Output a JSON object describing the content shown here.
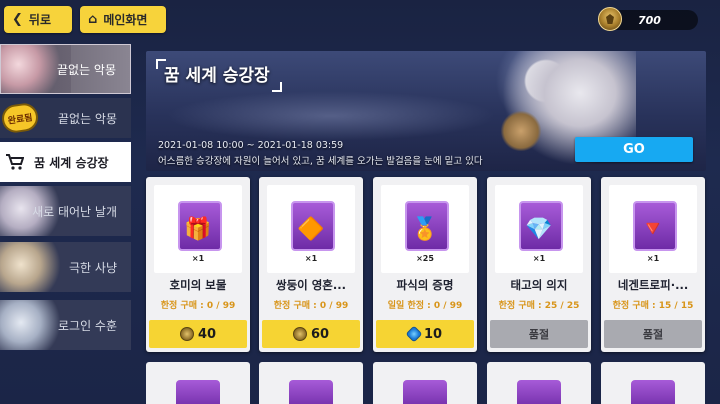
{
  "topbar": {
    "back_label": "뒤로",
    "main_label": "메인화면",
    "currency_value": "700"
  },
  "sidebar": {
    "items": [
      {
        "label": "끝없는 악몽"
      },
      {
        "label": "끝없는 악몽",
        "badge": "완료됨"
      },
      {
        "label": "꿈 세계 승강장"
      },
      {
        "label": "새로 태어난 날개"
      },
      {
        "label": "극한 사냥"
      },
      {
        "label": "로그인 수훈"
      }
    ]
  },
  "banner": {
    "title": "꿈 세계 승강장",
    "date": "2021-01-08 10:00 ~ 2021-01-18 03:59",
    "description": "어스름한 승강장에 자원이 늘어서 있고, 꿈 세계를 오가는 발걸음을 눈에 밑고 있다",
    "go_label": "GO"
  },
  "cards": [
    {
      "name": "호미의 보물",
      "qty": "×1",
      "limit": "한정 구매 : 0 / 99",
      "price": "40",
      "price_icon": "coin-icon"
    },
    {
      "name": "쌍둥이 영혼...",
      "qty": "×1",
      "limit": "한정 구매 : 0 / 99",
      "price": "60",
      "price_icon": "coin-icon"
    },
    {
      "name": "파식의 증명",
      "qty": "×25",
      "limit": "일일 한정 : 0 / 99",
      "price": "10",
      "price_icon": "crystal-icon"
    },
    {
      "name": "태고의 의지",
      "qty": "×1",
      "limit": "한정 구매 : 25 / 25",
      "price": "품절",
      "price_icon": ""
    },
    {
      "name": "네겐트로피·...",
      "qty": "×1",
      "limit": "한정 구매 : 15 / 15",
      "price": "품절",
      "price_icon": ""
    }
  ],
  "colors": {
    "accent_yellow": "#f6d433",
    "go_blue": "#17a9f2",
    "limit_orange": "#d8951a",
    "sold_gray": "#a9aab0",
    "item_purple": "#8a43c2"
  }
}
